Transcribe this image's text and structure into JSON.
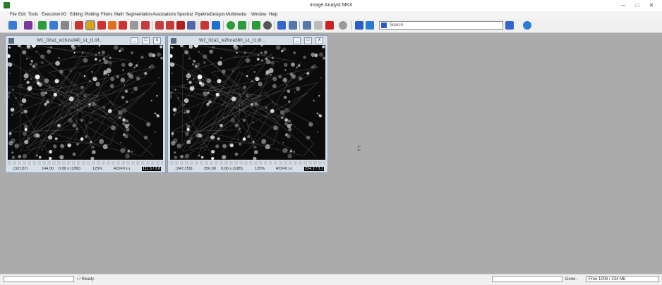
{
  "app": {
    "title": "Image Analyst MKII"
  },
  "window_controls": {
    "minimize": "─",
    "maximize": "□",
    "close": "✕"
  },
  "menu": [
    "File",
    "Edit",
    "Tools",
    "Execution",
    "I/O",
    "Editing",
    "Plotting",
    "Filters",
    "Math",
    "Segmentation",
    "Associations",
    "Spectral",
    "PipelineDesigns",
    "Multimedia",
    "Window",
    "Help"
  ],
  "toolbar": {
    "search_placeholder": "Search",
    "icon_colors": [
      "#3a7bd5",
      "#7a3a9a",
      "#2b9b3b",
      "#3a7bd5",
      "#888888",
      "#cc3333",
      "#d6a41c",
      "#cc3333",
      "#e07020",
      "#cc3333",
      "#999999",
      "#c43c3c",
      "#c43c3c",
      "#c43c3c",
      "#b02020",
      "#5566aa",
      "#cc3333",
      "#1f6fcc",
      "#2b9b3b",
      "#2b9b3b",
      "#2b9b3b",
      "#555555",
      "#3366cc",
      "#5577aa",
      "#5577aa",
      "#bbbbbb",
      "#cc2222",
      "#9a9a9a",
      "#2a5bc4",
      "#2a7bd5"
    ]
  },
  "image_windows": [
    {
      "title": "W1_02a1_w1fura340_s1_t1.tif...",
      "coords": "(337,87)",
      "value": "144.00",
      "time": "0.00 s (1/85)",
      "zoom": "125%",
      "roi": "ROI=0 (-)",
      "range": "111.5 / 3.8"
    },
    {
      "title": "W2_02a1_w2fura380_s1_t1.tif...",
      "coords": "(347,259)",
      "value": "256.00",
      "time": "0.00 s (1/85)",
      "zoom": "125%",
      "roi": "ROI=0 (-)",
      "range": "224.2 / 3.1"
    }
  ],
  "status": {
    "message": "/ / Ready.",
    "done": "Done.",
    "memory": "Free 1008 / 234 Mb"
  }
}
